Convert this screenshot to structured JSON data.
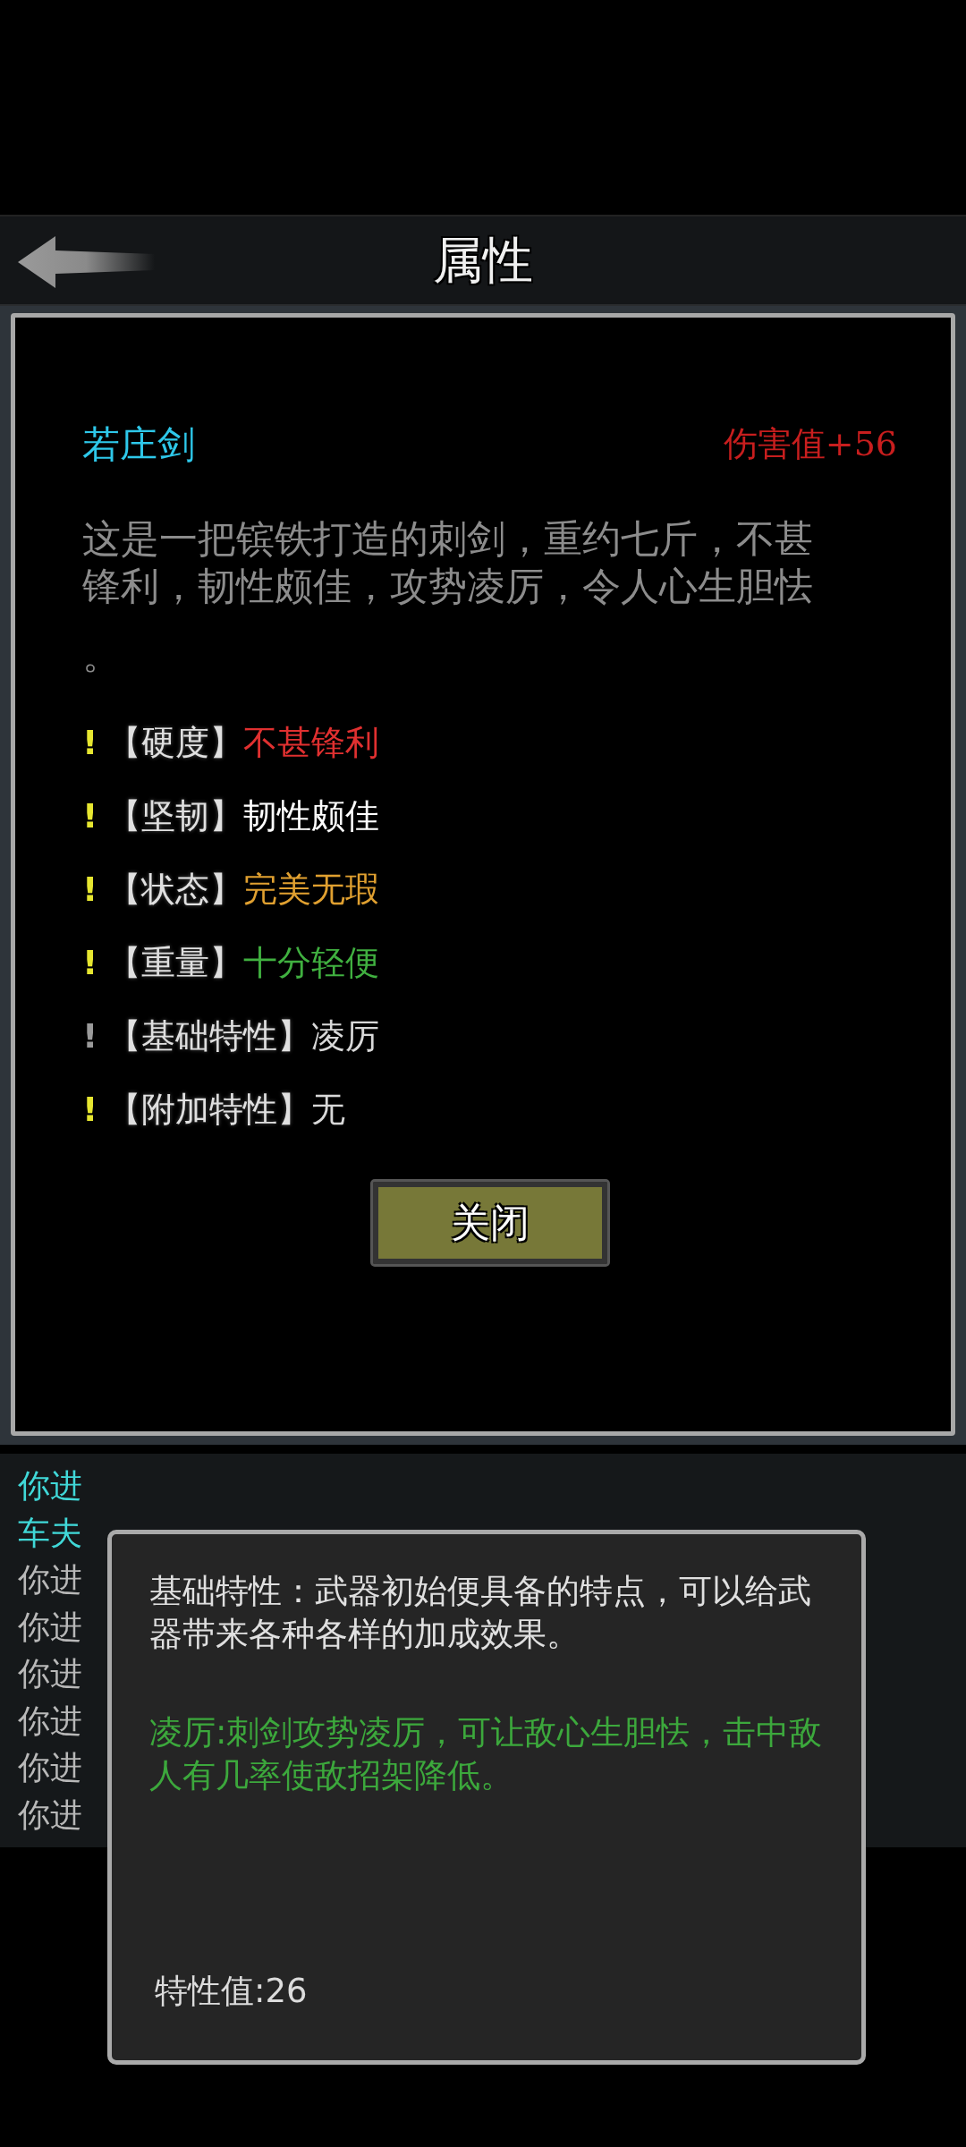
{
  "header": {
    "title": "属性"
  },
  "item": {
    "name": "若庄剑",
    "damage": "伤害值+56",
    "description": [
      "这是一把镔铁打造的刺剑，重约七斤，不甚",
      "锋利，韧性颇佳，攻势凌厉，令人心生胆怯",
      "。"
    ],
    "attributes": [
      {
        "mark": "!",
        "label": "【硬度】",
        "value": "不甚锋利",
        "color": "#e03030",
        "selected": false
      },
      {
        "mark": "!",
        "label": "【坚韧】",
        "value": "韧性颇佳",
        "color": "#ffffff",
        "selected": false
      },
      {
        "mark": "!",
        "label": "【状态】",
        "value": "完美无瑕",
        "color": "#e0a030",
        "selected": false
      },
      {
        "mark": "!",
        "label": "【重量】",
        "value": "十分轻便",
        "color": "#40b040",
        "selected": false
      },
      {
        "mark": "!",
        "label": "【基础特性】",
        "value": "凌厉",
        "color": "#d8d8d8",
        "selected": true
      },
      {
        "mark": "!",
        "label": "【附加特性】",
        "value": "无",
        "color": "#d8d8d8",
        "selected": false
      }
    ]
  },
  "close_button": "关闭",
  "log": [
    {
      "text": "你进",
      "color": "#40d8d8"
    },
    {
      "text": "车夫",
      "color": "#40d8d8"
    },
    {
      "text": "你进",
      "color": "#b8b8b8"
    },
    {
      "text": "你进",
      "color": "#b8b8b8"
    },
    {
      "text": "你进",
      "color": "#b8b8b8"
    },
    {
      "text": "你进",
      "color": "#b8b8b8"
    },
    {
      "text": "你进",
      "color": "#b8b8b8"
    },
    {
      "text": "你进",
      "color": "#b8b8b8"
    }
  ],
  "tooltip": {
    "description": "基础特性：武器初始便具备的特点，可以给武器带来各种各样的加成效果。",
    "effect": "凌厉:刺剑攻势凌厉，可让敌心生胆怯，击中敌人有几率使敌招架降低。",
    "value": "特性值:26"
  }
}
